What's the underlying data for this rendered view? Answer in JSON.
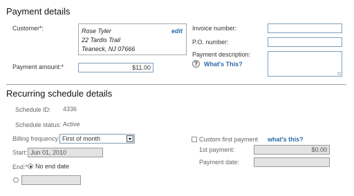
{
  "payment_details": {
    "title": "Payment details",
    "customer_label": "Customer*:",
    "customer_address": [
      "Rose Tyler",
      "22 Tardis Trail",
      "Teaneck, NJ 07666"
    ],
    "edit_link": "edit",
    "payment_amount_label": "Payment amount:*",
    "payment_amount_value": "$11.00",
    "invoice_number_label": "Invoice number:",
    "invoice_number_value": "",
    "po_number_label": "P.O. number:",
    "po_number_value": "",
    "payment_description_label": "Payment description:",
    "help_icon_glyph": "?",
    "whats_this_link": "What's This?"
  },
  "recurring": {
    "title": "Recurring schedule details",
    "schedule_id_label": "Schedule ID:",
    "schedule_id_value": "4336",
    "schedule_status_label": "Schedule status:",
    "schedule_status_value": "Active",
    "billing_frequency_label": "Billing frequency:*",
    "billing_frequency_value": "First of month",
    "start_label": "Start:*",
    "start_value": "Jun 01, 2010",
    "end_label": "End:*",
    "end_option_no_end": "No end date",
    "end_option_no_end_selected": true,
    "end_date_value": "",
    "custom_first_payment_label": "Custom first payment",
    "custom_first_payment_checked": false,
    "whats_this_link": "what's this?",
    "first_payment_label": "1st payment:",
    "first_payment_value": "$0.00",
    "payment_date_label": "Payment date:",
    "payment_date_value": ""
  },
  "icons": {
    "help": "help-icon",
    "dropdown": "chevron-down-icon",
    "resize": "resize-grip-icon"
  },
  "colors": {
    "link": "#2b6aa8",
    "input_border": "#7f9db9",
    "disabled_input_bg": "#e3e3e3",
    "divider": "#a0a0a0"
  }
}
